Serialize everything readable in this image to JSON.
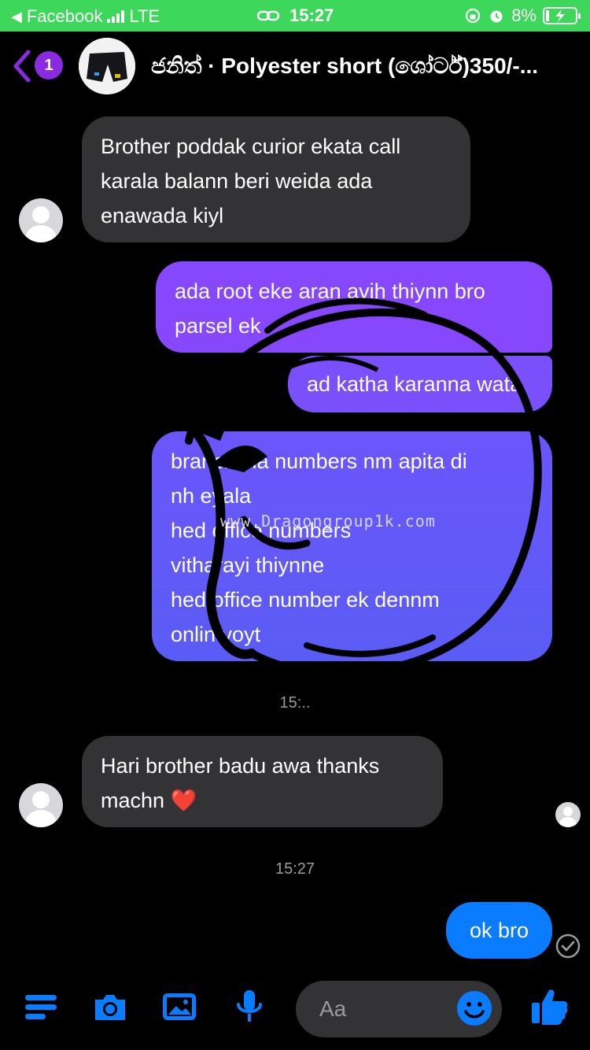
{
  "status": {
    "back_app": "Facebook",
    "network": "LTE",
    "time": "15:27",
    "battery": "8%"
  },
  "header": {
    "unread_count": "1",
    "title": "ජනිත් · Polyester short (ශෝර්ට්)350/-..."
  },
  "messages": [
    {
      "from": "them",
      "text": "Brother poddak curior ekata call\nkarala balann beri weida ada\nenawada kiyl"
    },
    {
      "from": "me",
      "text": "ada root eke aran avih thiynn bro\nparsel ek"
    },
    {
      "from": "me",
      "text": "ad katha karanna wata"
    },
    {
      "from": "me",
      "text": "branch vla numbers nm apita di\nnh eyala\nhed office numbers\nvitharayi thiynne\nhed office number ek dennm\nonlin yoyt"
    },
    {
      "from": "them",
      "text": "Hari brother badu awa thanks\nmachn ❤️"
    },
    {
      "from": "me",
      "text": "ok bro"
    }
  ],
  "timestamps": [
    "15:..",
    "15:27"
  ],
  "watermark": "www.Dragongroup1k.com",
  "composer": {
    "placeholder": "Aa"
  },
  "colors": {
    "accent": "#0a7cff",
    "out_gradient_top": "#8b4bff",
    "out_gradient_bottom": "#5a5cf5",
    "incoming_bubble": "#333335"
  }
}
